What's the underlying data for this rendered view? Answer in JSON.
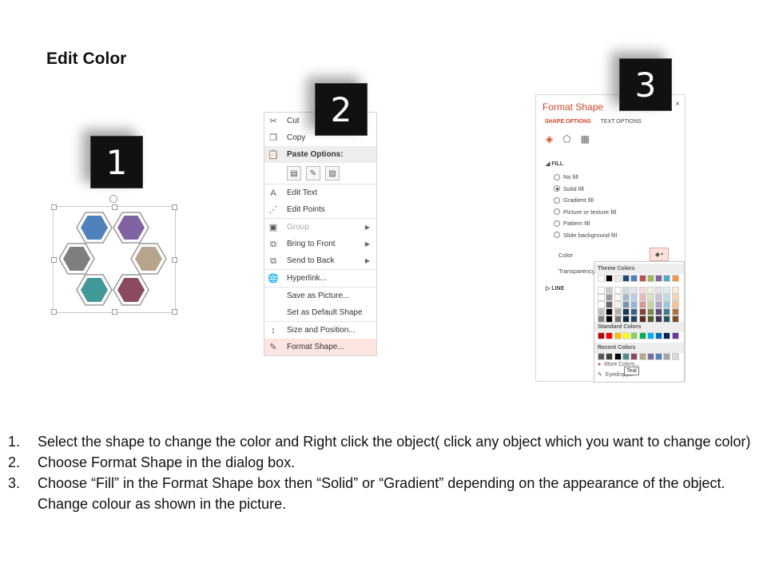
{
  "title": "Edit Color",
  "badges": [
    "1",
    "2",
    "3"
  ],
  "context_menu": {
    "items": [
      {
        "label": "Cut",
        "icon": "scissors-icon",
        "glyph": "✂",
        "type": "normal"
      },
      {
        "label": "Copy",
        "icon": "copy-icon",
        "glyph": "❐",
        "type": "normal"
      },
      {
        "label": "Paste Options:",
        "icon": "paste-icon",
        "glyph": "📋",
        "type": "header"
      },
      {
        "label": "Edit Text",
        "icon": "edit-text-icon",
        "glyph": "A",
        "type": "normal"
      },
      {
        "label": "Edit Points",
        "icon": "edit-points-icon",
        "glyph": "⋰",
        "type": "normal"
      },
      {
        "label": "Group",
        "icon": "group-icon",
        "glyph": "▣",
        "type": "disabled",
        "submenu": true
      },
      {
        "label": "Bring to Front",
        "icon": "bring-to-front-icon",
        "glyph": "⧉",
        "type": "normal",
        "submenu": true
      },
      {
        "label": "Send to Back",
        "icon": "send-to-back-icon",
        "glyph": "⧉",
        "type": "normal",
        "submenu": true
      },
      {
        "label": "Hyperlink...",
        "icon": "hyperlink-icon",
        "glyph": "🌐",
        "type": "normal"
      },
      {
        "label": "Save as Picture...",
        "icon": "",
        "glyph": "",
        "type": "normal"
      },
      {
        "label": "Set as Default Shape",
        "icon": "",
        "glyph": "",
        "type": "normal"
      },
      {
        "label": "Size and Position...",
        "icon": "size-position-icon",
        "glyph": "↕",
        "type": "normal"
      },
      {
        "label": "Format Shape...",
        "icon": "format-shape-icon",
        "glyph": "✎",
        "type": "highlight"
      }
    ]
  },
  "format_pane": {
    "title": "Format Shape",
    "close_glyph": "×",
    "tabs": [
      "SHAPE OPTIONS",
      "TEXT OPTIONS"
    ],
    "icons": [
      "fill-line-icon",
      "effects-icon",
      "size-properties-icon"
    ],
    "fill_section": "FILL",
    "fill_options": [
      {
        "label": "No fill",
        "selected": false
      },
      {
        "label": "Solid fill",
        "selected": true
      },
      {
        "label": "Gradient fill",
        "selected": false
      },
      {
        "label": "Picture or texture fill",
        "selected": false
      },
      {
        "label": "Pattern fill",
        "selected": false
      },
      {
        "label": "Slide background fill",
        "selected": false
      }
    ],
    "color_label": "Color",
    "transparency_label": "Transparency",
    "line_section": "LINE"
  },
  "palette": {
    "theme_header": "Theme Colors",
    "standard_header": "Standard Colors",
    "recent_header": "Recent Colors",
    "more_colors": "More Colors...",
    "eyedropper": "Eyedropper",
    "tooltip": "Teal",
    "theme_base": [
      "#ffffff",
      "#000000",
      "#eeece1",
      "#1f497d",
      "#4f81bd",
      "#c0504d",
      "#9bbb59",
      "#8064a2",
      "#4bacc6",
      "#f79646"
    ],
    "standard": [
      "#c00000",
      "#ff0000",
      "#ffc000",
      "#ffff00",
      "#92d050",
      "#00b050",
      "#00b0f0",
      "#0070c0",
      "#002060",
      "#7030a0"
    ],
    "recent": [
      "#595959",
      "#404040",
      "#000000",
      "#4e8f8e",
      "#8b4a5e",
      "#b6a48c",
      "#7f6a9e",
      "#4f81bd",
      "#a6a6a6",
      "#d9d9d9"
    ]
  },
  "hexagon_colors": {
    "top_left": "#4f81bd",
    "top_right": "#8064a2",
    "mid_left": "#7f7f7f",
    "mid_right": "#b6a48c",
    "bottom_left": "#3f9a97",
    "bottom_right": "#8b4a5e"
  },
  "instructions": [
    {
      "num": "1.",
      "text": "Select the shape to change the color and Right click the object( click any object which you want to change color)"
    },
    {
      "num": "2.",
      "text": "Choose Format Shape in the dialog box."
    },
    {
      "num": "3.",
      "text": "Choose “Fill” in the Format Shape box then “Solid” or “Gradient” depending on the appearance of the object. Change colour as shown in the picture."
    }
  ]
}
